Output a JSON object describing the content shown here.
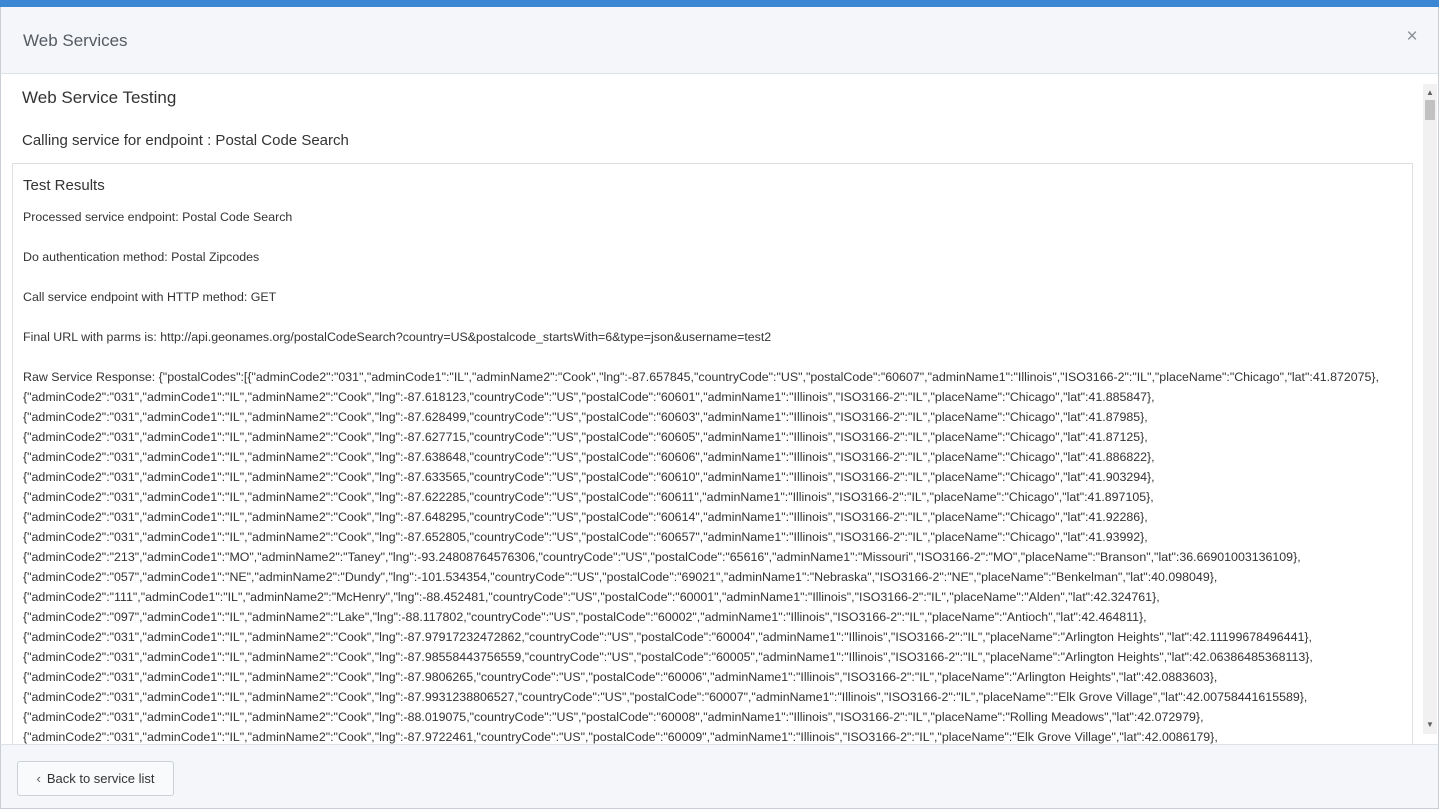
{
  "header": {
    "title": "Web Services",
    "close_label": "×"
  },
  "body": {
    "heading": "Web Service Testing",
    "endpoint_line": "Calling service for endpoint : Postal Code Search"
  },
  "results": {
    "title": "Test Results",
    "lines": [
      "Processed service endpoint: Postal Code Search",
      "Do authentication method: Postal Zipcodes",
      "Call service endpoint with HTTP method: GET",
      "Final URL with parms is: http://api.geonames.org/postalCodeSearch?country=US&postalcode_startsWith=6&type=json&username=test2"
    ],
    "raw_response": [
      "Raw Service Response: {\"postalCodes\":[{\"adminCode2\":\"031\",\"adminCode1\":\"IL\",\"adminName2\":\"Cook\",\"lng\":-87.657845,\"countryCode\":\"US\",\"postalCode\":\"60607\",\"adminName1\":\"Illinois\",\"ISO3166-2\":\"IL\",\"placeName\":\"Chicago\",\"lat\":41.872075},",
      "{\"adminCode2\":\"031\",\"adminCode1\":\"IL\",\"adminName2\":\"Cook\",\"lng\":-87.618123,\"countryCode\":\"US\",\"postalCode\":\"60601\",\"adminName1\":\"Illinois\",\"ISO3166-2\":\"IL\",\"placeName\":\"Chicago\",\"lat\":41.885847},",
      "{\"adminCode2\":\"031\",\"adminCode1\":\"IL\",\"adminName2\":\"Cook\",\"lng\":-87.628499,\"countryCode\":\"US\",\"postalCode\":\"60603\",\"adminName1\":\"Illinois\",\"ISO3166-2\":\"IL\",\"placeName\":\"Chicago\",\"lat\":41.87985},",
      "{\"adminCode2\":\"031\",\"adminCode1\":\"IL\",\"adminName2\":\"Cook\",\"lng\":-87.627715,\"countryCode\":\"US\",\"postalCode\":\"60605\",\"adminName1\":\"Illinois\",\"ISO3166-2\":\"IL\",\"placeName\":\"Chicago\",\"lat\":41.87125},",
      "{\"adminCode2\":\"031\",\"adminCode1\":\"IL\",\"adminName2\":\"Cook\",\"lng\":-87.638648,\"countryCode\":\"US\",\"postalCode\":\"60606\",\"adminName1\":\"Illinois\",\"ISO3166-2\":\"IL\",\"placeName\":\"Chicago\",\"lat\":41.886822},",
      "{\"adminCode2\":\"031\",\"adminCode1\":\"IL\",\"adminName2\":\"Cook\",\"lng\":-87.633565,\"countryCode\":\"US\",\"postalCode\":\"60610\",\"adminName1\":\"Illinois\",\"ISO3166-2\":\"IL\",\"placeName\":\"Chicago\",\"lat\":41.903294},",
      "{\"adminCode2\":\"031\",\"adminCode1\":\"IL\",\"adminName2\":\"Cook\",\"lng\":-87.622285,\"countryCode\":\"US\",\"postalCode\":\"60611\",\"adminName1\":\"Illinois\",\"ISO3166-2\":\"IL\",\"placeName\":\"Chicago\",\"lat\":41.897105},",
      "{\"adminCode2\":\"031\",\"adminCode1\":\"IL\",\"adminName2\":\"Cook\",\"lng\":-87.648295,\"countryCode\":\"US\",\"postalCode\":\"60614\",\"adminName1\":\"Illinois\",\"ISO3166-2\":\"IL\",\"placeName\":\"Chicago\",\"lat\":41.92286},",
      "{\"adminCode2\":\"031\",\"adminCode1\":\"IL\",\"adminName2\":\"Cook\",\"lng\":-87.652805,\"countryCode\":\"US\",\"postalCode\":\"60657\",\"adminName1\":\"Illinois\",\"ISO3166-2\":\"IL\",\"placeName\":\"Chicago\",\"lat\":41.93992},",
      "{\"adminCode2\":\"213\",\"adminCode1\":\"MO\",\"adminName2\":\"Taney\",\"lng\":-93.24808764576306,\"countryCode\":\"US\",\"postalCode\":\"65616\",\"adminName1\":\"Missouri\",\"ISO3166-2\":\"MO\",\"placeName\":\"Branson\",\"lat\":36.66901003136109},",
      "{\"adminCode2\":\"057\",\"adminCode1\":\"NE\",\"adminName2\":\"Dundy\",\"lng\":-101.534354,\"countryCode\":\"US\",\"postalCode\":\"69021\",\"adminName1\":\"Nebraska\",\"ISO3166-2\":\"NE\",\"placeName\":\"Benkelman\",\"lat\":40.098049},",
      "{\"adminCode2\":\"111\",\"adminCode1\":\"IL\",\"adminName2\":\"McHenry\",\"lng\":-88.452481,\"countryCode\":\"US\",\"postalCode\":\"60001\",\"adminName1\":\"Illinois\",\"ISO3166-2\":\"IL\",\"placeName\":\"Alden\",\"lat\":42.324761},",
      "{\"adminCode2\":\"097\",\"adminCode1\":\"IL\",\"adminName2\":\"Lake\",\"lng\":-88.117802,\"countryCode\":\"US\",\"postalCode\":\"60002\",\"adminName1\":\"Illinois\",\"ISO3166-2\":\"IL\",\"placeName\":\"Antioch\",\"lat\":42.464811},",
      "{\"adminCode2\":\"031\",\"adminCode1\":\"IL\",\"adminName2\":\"Cook\",\"lng\":-87.97917232472862,\"countryCode\":\"US\",\"postalCode\":\"60004\",\"adminName1\":\"Illinois\",\"ISO3166-2\":\"IL\",\"placeName\":\"Arlington Heights\",\"lat\":42.11199678496441},",
      "{\"adminCode2\":\"031\",\"adminCode1\":\"IL\",\"adminName2\":\"Cook\",\"lng\":-87.98558443756559,\"countryCode\":\"US\",\"postalCode\":\"60005\",\"adminName1\":\"Illinois\",\"ISO3166-2\":\"IL\",\"placeName\":\"Arlington Heights\",\"lat\":42.06386485368113},",
      "{\"adminCode2\":\"031\",\"adminCode1\":\"IL\",\"adminName2\":\"Cook\",\"lng\":-87.9806265,\"countryCode\":\"US\",\"postalCode\":\"60006\",\"adminName1\":\"Illinois\",\"ISO3166-2\":\"IL\",\"placeName\":\"Arlington Heights\",\"lat\":42.0883603},",
      "{\"adminCode2\":\"031\",\"adminCode1\":\"IL\",\"adminName2\":\"Cook\",\"lng\":-87.9931238806527,\"countryCode\":\"US\",\"postalCode\":\"60007\",\"adminName1\":\"Illinois\",\"ISO3166-2\":\"IL\",\"placeName\":\"Elk Grove Village\",\"lat\":42.00758441615589},",
      "{\"adminCode2\":\"031\",\"adminCode1\":\"IL\",\"adminName2\":\"Cook\",\"lng\":-88.019075,\"countryCode\":\"US\",\"postalCode\":\"60008\",\"adminName1\":\"Illinois\",\"ISO3166-2\":\"IL\",\"placeName\":\"Rolling Meadows\",\"lat\":42.072979},",
      "{\"adminCode2\":\"031\",\"adminCode1\":\"IL\",\"adminName2\":\"Cook\",\"lng\":-87.9722461,\"countryCode\":\"US\",\"postalCode\":\"60009\",\"adminName1\":\"Illinois\",\"ISO3166-2\":\"IL\",\"placeName\":\"Elk Grove Village\",\"lat\":42.0086179},"
    ]
  },
  "footer": {
    "back_label": "Back to service list"
  },
  "icons": {
    "close": "close-icon",
    "back": "chevron-left-icon",
    "scroll_up": "scroll-up-arrow-icon",
    "scroll_down": "scroll-down-arrow-icon"
  },
  "colors": {
    "accent_bar": "#3b87d4",
    "header_bg": "#f4f6f9"
  }
}
